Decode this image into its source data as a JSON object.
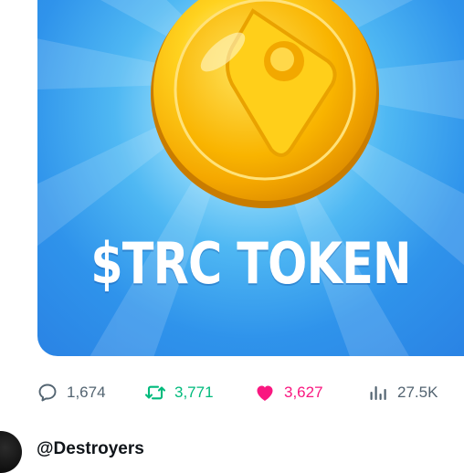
{
  "media": {
    "headline": "$TRC TOKEN"
  },
  "actions": {
    "replies": "1,674",
    "reposts": "3,771",
    "likes": "3,627",
    "views": "27.5K"
  },
  "next_post": {
    "username": "@Destroyers"
  },
  "colors": {
    "repost": "#00ba7c",
    "like": "#f91880",
    "muted": "#536471",
    "media_blue": "#2f93eb",
    "coin_gold": "#f7b500"
  },
  "icons": [
    "reply-icon",
    "repost-icon",
    "heart-icon",
    "views-icon",
    "coin-logo"
  ]
}
